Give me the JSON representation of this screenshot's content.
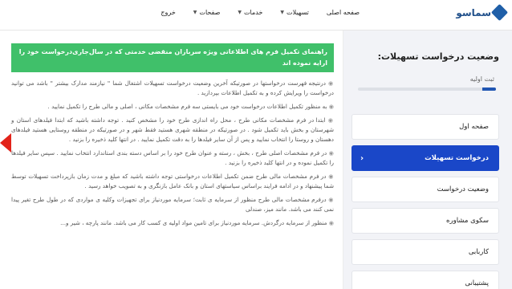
{
  "header": {
    "logo_text": "سماسو",
    "nav": [
      {
        "label": "صفحه اصلی",
        "has_dropdown": false
      },
      {
        "label": "تسهیلات",
        "has_dropdown": true
      },
      {
        "label": "خدمات",
        "has_dropdown": true
      },
      {
        "label": "صفحات",
        "has_dropdown": true
      },
      {
        "label": "خروج",
        "has_dropdown": false
      }
    ]
  },
  "sidebar": {
    "title": "وضعیت درخواست تسهیلات:",
    "step_label": "ثبت اولیه",
    "progress_fraction": 0.1,
    "items": [
      {
        "label": "صفحه اول",
        "active": false
      },
      {
        "label": "درخواست تسهیلات",
        "active": true
      },
      {
        "label": "وضعیت درخواست",
        "active": false
      },
      {
        "label": "سکوی مشاوره",
        "active": false
      },
      {
        "label": "کاربابی",
        "active": false
      },
      {
        "label": "پشتیبانی",
        "active": false
      }
    ],
    "active_arrow": "‹"
  },
  "main": {
    "banner": "راهنمای تکمیل فرم های اطلاعاتی ویژه سربازان منقضی خدمتی که در سال‌جاری‌درخواست خود را ارایه نموده اند",
    "paragraphs": [
      "درنتیجه فهرست درخواستها در صورتیکه آخرین وضعیت درخواست تسهیلات اشتغال شما \" نیازمند مدارک بیشتر \" باشد می توانید درخواست را ویرایش کرده و به تکمیل اطلاعات بپردازید .",
      "به منظور تکمیل اطلاعات درخواست خود می بایستی سه فرم مشخصات مکانی ، اصلی و مالی طرح را تکمیل نمایید .",
      "ابتدا در فرم مشخصات مکانی طرح ، محل راه اندازی طرح خود را مشخص کنید . توجه داشته باشید که ابتدا فیلدهای استان و شهرستان و بخش باید تکمیل شود . در صورتیکه در منطقه شهری هستید فقط شهر و در صورتیکه در منطقه روستایی هستید فیلدهای دهستان و روستا را انتخاب نمایید و پس از آن سایر فیلدها را به دقت تکمیل نمایید . در انتها کلید ذخیره را بزنید .",
      "در فرم مشخصات اصلی طرح ، بخش ، رسته و عنوان طرح خود را بر اساس دسته بندی استاندارد انتخاب نمایید . سپس سایر فیلدها را تکمیل نموده و در انتها کلید ذخیره را بزنید .",
      "در فرم مشخصات مالی طرح ضمن تکمیل اطلاعات درخواستی توجه داشته باشید که مبلغ و مدت زمان بازپرداخت تسهیلات توسط شما پیشنهاد و در ادامه فرایند براساس سیاستهای استان و بانک عامل بازنگری و به تصویب خواهد رسید .",
      "درفرم مشخصات مالی طرح منظور از سرمایه ی ثابت؛ سرمایه موردنیاز برای تجهیزات وکلیه ی مواردی که در طول طرح تغیر پیدا نمی کنند می باشد. مانند میز، صندلی",
      "منظور از سرمایه درگردش. سرمایه موردنیاز برای تامین مواد اولیه ی کسب کار می باشد. مانند پارچه ، شیر و..."
    ]
  },
  "colors": {
    "accent_blue": "#1a47c8",
    "banner_green": "#40c06a",
    "marker_red": "#e2231a"
  }
}
